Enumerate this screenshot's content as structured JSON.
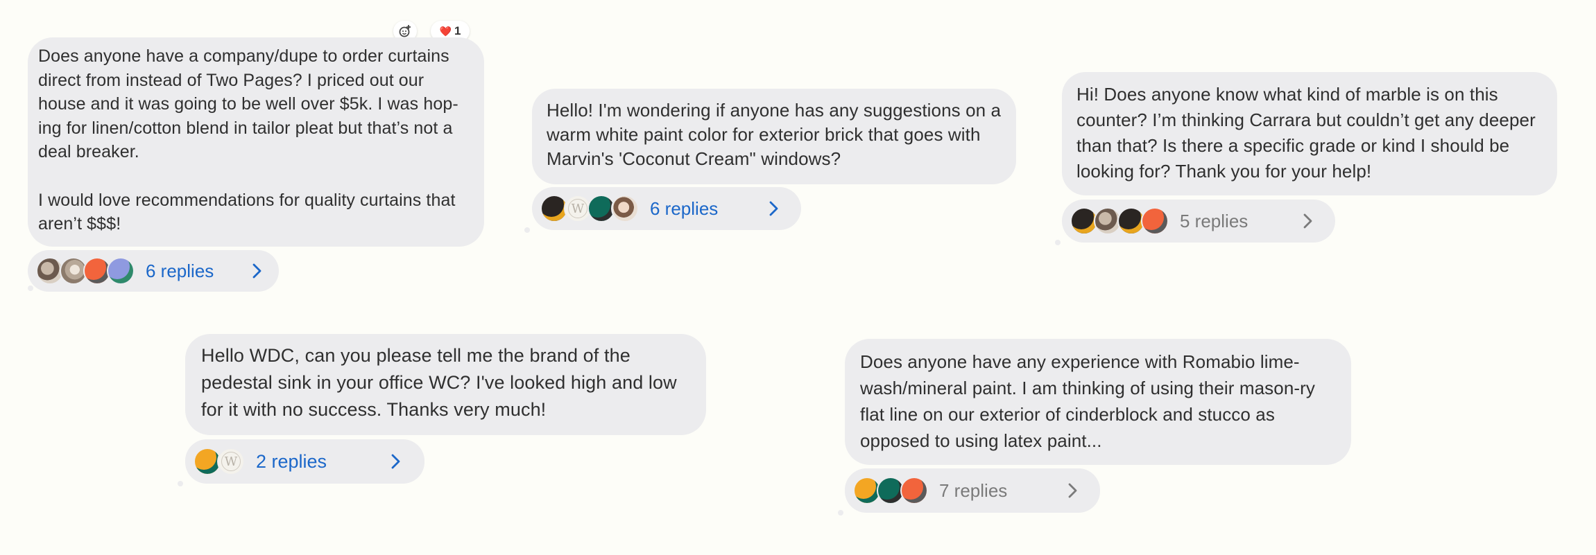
{
  "messages": [
    {
      "paragraphs": [
        "Does anyone have a company/dupe to order curtains direct from instead of Two Pages? I priced out our house and it was going to be well over $5k. I was hop-ing for linen/cotton blend in tailor pleat but that’s not a deal breaker.",
        "I would love recommendations for quality curtains that aren’t $$$!"
      ],
      "reactions": {
        "add_icon": "add-reaction-icon",
        "heart_emoji": "❤️",
        "heart_count": "1"
      },
      "replies_label": "6 replies"
    },
    {
      "paragraphs": [
        "Hello! I'm wondering if anyone has any suggestions on a warm white paint color for exterior brick that goes with Marvin's 'Coconut Cream\" windows?"
      ],
      "replies_label": "6 replies"
    },
    {
      "paragraphs": [
        "Hi! Does anyone know what kind of marble is on this counter? I’m thinking Carrara but couldn’t get any deeper than that? Is there a specific grade or kind I should be looking for? Thank you for your help!"
      ],
      "replies_label": "5 replies"
    },
    {
      "paragraphs": [
        "Hello WDC, can you please tell me the brand of the pedestal sink in your office WC? I've looked high and low for it with no success. Thanks very much!"
      ],
      "replies_label": "2 replies"
    },
    {
      "paragraphs": [
        "Does anyone have any experience with Romabio lime-wash/mineral paint. I am thinking of using their mason-ry flat line on our exterior of cinderblock and stucco as opposed to using latex paint..."
      ],
      "replies_label": "7 replies"
    }
  ],
  "avatar_logo_letter": "W",
  "colors": {
    "background": "#fdfdf8",
    "bubble": "#ececee",
    "link_blue": "#1b67c9",
    "muted_gray": "#7a7a7a"
  }
}
